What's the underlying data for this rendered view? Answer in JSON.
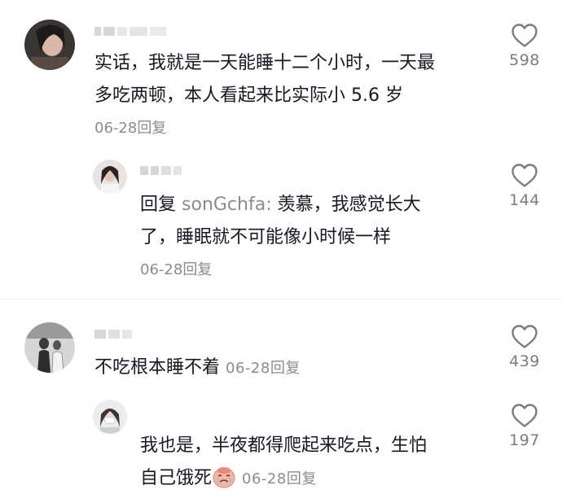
{
  "comments": [
    {
      "text_line1": "实话，我就是一天能睡十二个小时，一天最",
      "text_line2": "多吃两顿，本人看起来比实际小 5.6 岁",
      "date": "06-28",
      "reply_label": "回复",
      "likes": "598",
      "like_icon": "heart-outline-icon"
    },
    {
      "reply_prefix": "回复",
      "mention": "sonGchfa:",
      "text_line1": "羡慕，我感觉长大",
      "text_line2": "了，睡眠就不可能像小时候一样",
      "date": "06-28",
      "reply_label": "回复",
      "likes": "144",
      "like_icon": "heart-outline-icon"
    },
    {
      "text": "不吃根本睡不着",
      "date": "06-28",
      "reply_label": "回复",
      "likes": "439",
      "like_icon": "heart-outline-icon"
    },
    {
      "text_line1": "我也是，半夜都得爬起来吃点，生怕",
      "text_line2": "自己饿死",
      "emoji": "crying-face-emoji",
      "date": "06-28",
      "reply_label": "回复",
      "likes": "197",
      "like_icon": "heart-outline-icon"
    }
  ],
  "colors": {
    "text": "#161823",
    "meta": "#8a8b91",
    "like_count": "#7b7c82"
  }
}
